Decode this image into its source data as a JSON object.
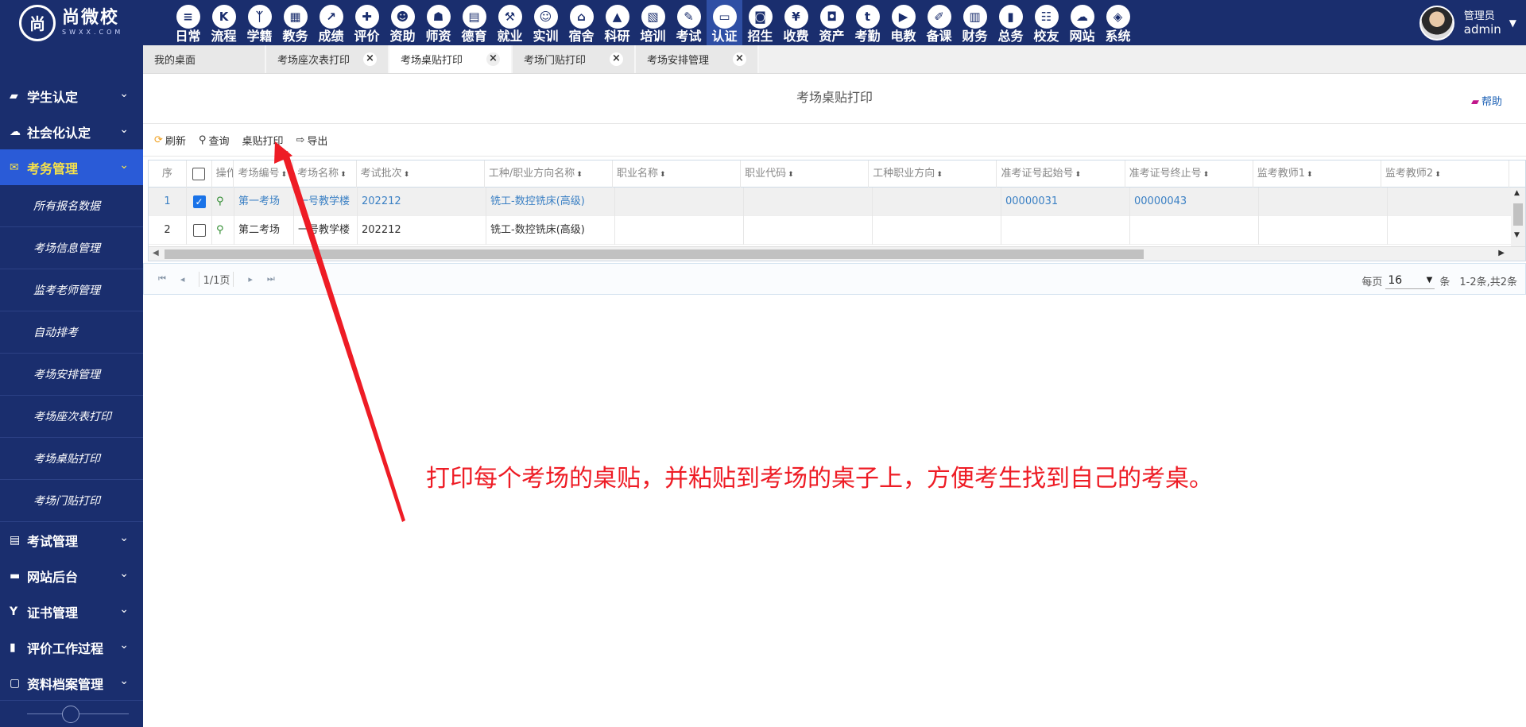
{
  "app": {
    "logo_cn": "尚微校",
    "logo_en": "SWXX.COM",
    "logo_mark": "尚"
  },
  "modules": [
    {
      "label": "日常",
      "icon": "document-icon",
      "glyph": "≡"
    },
    {
      "label": "流程",
      "icon": "flow-icon",
      "glyph": "K"
    },
    {
      "label": "学籍",
      "icon": "student-icon",
      "glyph": "ᛉ"
    },
    {
      "label": "教务",
      "icon": "calendar-icon",
      "glyph": "▦"
    },
    {
      "label": "成绩",
      "icon": "chart-icon",
      "glyph": "↗"
    },
    {
      "label": "评价",
      "icon": "evaluate-icon",
      "glyph": "✚"
    },
    {
      "label": "资助",
      "icon": "person-icon",
      "glyph": "☻"
    },
    {
      "label": "师资",
      "icon": "teacher-icon",
      "glyph": "☗"
    },
    {
      "label": "德育",
      "icon": "book-icon",
      "glyph": "▤"
    },
    {
      "label": "就业",
      "icon": "hammer-icon",
      "glyph": "⚒"
    },
    {
      "label": "实训",
      "icon": "robot-icon",
      "glyph": "☺"
    },
    {
      "label": "宿舍",
      "icon": "home-icon",
      "glyph": "⌂"
    },
    {
      "label": "科研",
      "icon": "graduation-icon",
      "glyph": "▲"
    },
    {
      "label": "培训",
      "icon": "image-icon",
      "glyph": "▧"
    },
    {
      "label": "考试",
      "icon": "wrench-icon",
      "glyph": "✎"
    },
    {
      "label": "认证",
      "icon": "monitor-icon",
      "glyph": "▭"
    },
    {
      "label": "招生",
      "icon": "bus-icon",
      "glyph": "◙"
    },
    {
      "label": "收费",
      "icon": "yen-icon",
      "glyph": "¥"
    },
    {
      "label": "资产",
      "icon": "train-icon",
      "glyph": "◘"
    },
    {
      "label": "考勤",
      "icon": "tumblr-icon",
      "glyph": "t"
    },
    {
      "label": "电教",
      "icon": "file-video-icon",
      "glyph": "▶"
    },
    {
      "label": "备课",
      "icon": "edit-icon",
      "glyph": "✐"
    },
    {
      "label": "财务",
      "icon": "newspaper-icon",
      "glyph": "▥"
    },
    {
      "label": "总务",
      "icon": "bar-chart-icon",
      "glyph": "▮"
    },
    {
      "label": "校友",
      "icon": "users-icon",
      "glyph": "☷"
    },
    {
      "label": "网站",
      "icon": "cloud-icon",
      "glyph": "☁"
    },
    {
      "label": "系统",
      "icon": "cube-icon",
      "glyph": "◈"
    }
  ],
  "active_module": "认证",
  "user": {
    "role": "管理员",
    "name": "admin"
  },
  "sidebar": {
    "groups_top": [
      {
        "label": "学生认定",
        "icon": "book-icon",
        "glyph": "▰"
      },
      {
        "label": "社会化认定",
        "icon": "cloud-icon",
        "glyph": "☁"
      },
      {
        "label": "考务管理",
        "icon": "envelope-icon",
        "glyph": "✉"
      }
    ],
    "sub_items": [
      "所有报名数据",
      "考场信息管理",
      "监考老师管理",
      "自动排考",
      "考场安排管理",
      "考场座次表打印",
      "考场桌贴打印",
      "考场门贴打印"
    ],
    "groups_bottom": [
      {
        "label": "考试管理",
        "icon": "file-icon",
        "glyph": "▤"
      },
      {
        "label": "网站后台",
        "icon": "folder-icon",
        "glyph": "▬"
      },
      {
        "label": "证书管理",
        "icon": "certificate-icon",
        "glyph": "Y"
      },
      {
        "label": "评价工作过程",
        "icon": "columns-icon",
        "glyph": "▮"
      },
      {
        "label": "资料档案管理",
        "icon": "archive-icon",
        "glyph": "▢"
      }
    ]
  },
  "tabs": [
    {
      "label": "我的桌面",
      "closable": false,
      "active": false
    },
    {
      "label": "考场座次表打印",
      "closable": true,
      "active": false
    },
    {
      "label": "考场桌贴打印",
      "closable": true,
      "active": true
    },
    {
      "label": "考场门贴打印",
      "closable": true,
      "active": false
    },
    {
      "label": "考场安排管理",
      "closable": true,
      "active": false
    }
  ],
  "page": {
    "title": "考场桌贴打印",
    "help": "帮助"
  },
  "toolbar": {
    "refresh": "刷新",
    "query": "查询",
    "print": "桌贴打印",
    "export": "导出"
  },
  "table": {
    "columns": [
      "序",
      "",
      "操作",
      "考场编号",
      "考场名称",
      "考试批次",
      "工种/职业方向名称",
      "职业名称",
      "职业代码",
      "工种职业方向",
      "准考证号起始号",
      "准考证号终止号",
      "监考教师1",
      "监考教师2",
      ""
    ],
    "rows": [
      {
        "seq": "1",
        "checked": true,
        "code": "第一考场",
        "name": "一号教学楼",
        "batch": "202212",
        "trade": "铣工-数控铣床(高级)",
        "occ_name": "",
        "occ_code": "",
        "occ_dir": "",
        "start_no": "00000031",
        "end_no": "00000043",
        "t1": "",
        "t2": ""
      },
      {
        "seq": "2",
        "checked": false,
        "code": "第二考场",
        "name": "一号教学楼",
        "batch": "202212",
        "trade": "铣工-数控铣床(高级)",
        "occ_name": "",
        "occ_code": "",
        "occ_dir": "",
        "start_no": "",
        "end_no": "",
        "t1": "",
        "t2": ""
      }
    ]
  },
  "pager": {
    "page_info": "1/1页",
    "per_page_label": "每页",
    "per_page": "16",
    "unit": "条",
    "summary": "1-2条,共2条"
  },
  "annotation": "打印每个考场的桌贴，并粘贴到考场的桌子上，方便考生找到自己的考桌。",
  "colors": {
    "nav_bg": "#1a2e6e",
    "active_group_bg": "#2a5bd7",
    "active_group_text": "#f7e24a",
    "annotation": "#ee1c25",
    "link": "#3b80c4"
  }
}
